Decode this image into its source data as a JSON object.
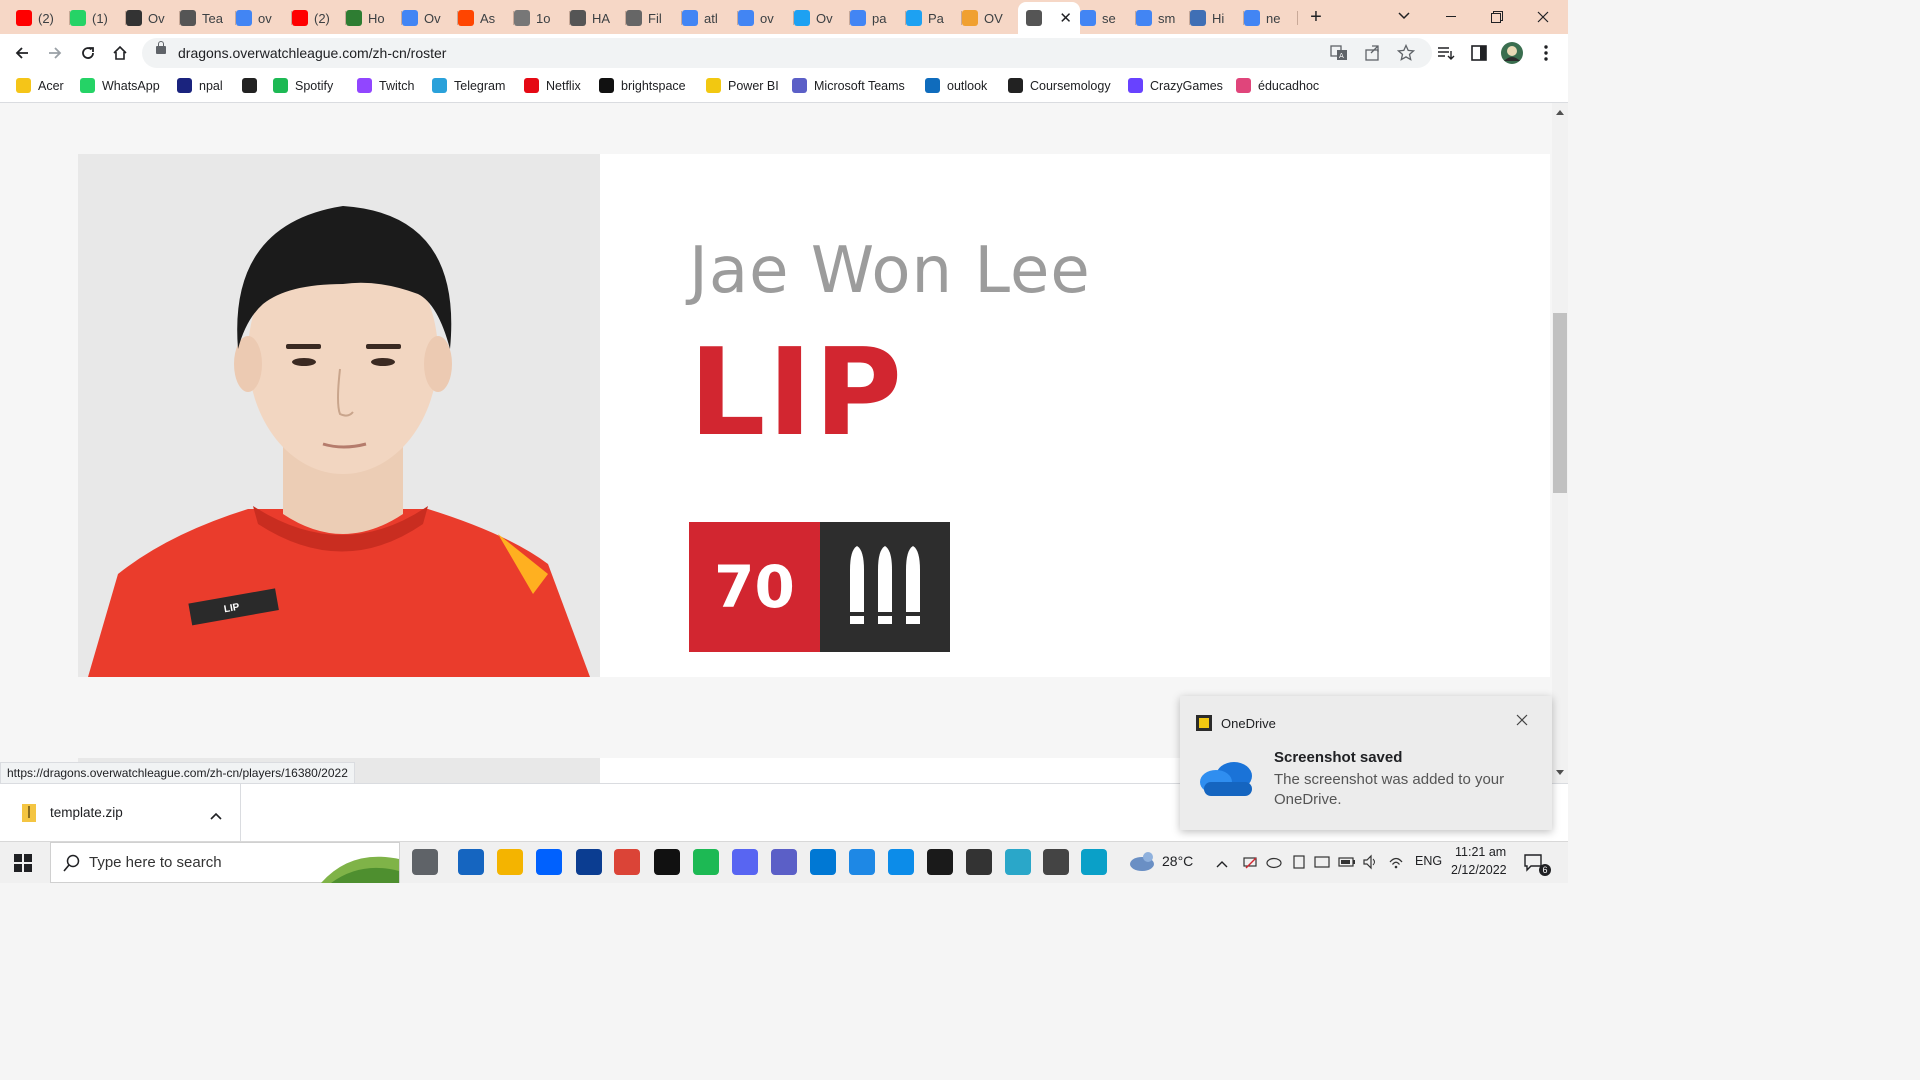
{
  "tabs": [
    {
      "label": "(2)",
      "icon": "youtube-icon",
      "color": "#ff0000"
    },
    {
      "label": "(1)",
      "icon": "whatsapp-icon",
      "color": "#25d366"
    },
    {
      "label": "Ov",
      "icon": "overwatch-icon",
      "color": "#333333"
    },
    {
      "label": "Tea",
      "icon": "flag-icon",
      "color": "#555555"
    },
    {
      "label": "ov",
      "icon": "google-icon",
      "color": "#4285f4"
    },
    {
      "label": "(2)",
      "icon": "youtube-icon",
      "color": "#ff0000"
    },
    {
      "label": "Ho",
      "icon": "w-icon",
      "color": "#2e7d32"
    },
    {
      "label": "Ov",
      "icon": "google-icon",
      "color": "#4285f4"
    },
    {
      "label": "As",
      "icon": "reddit-icon",
      "color": "#ff4500"
    },
    {
      "label": "1o",
      "icon": "globe-icon",
      "color": "#777777"
    },
    {
      "label": "HA",
      "icon": "flag-icon",
      "color": "#555555"
    },
    {
      "label": "Fil",
      "icon": "puzzle-icon",
      "color": "#666666"
    },
    {
      "label": "atl",
      "icon": "google-icon",
      "color": "#4285f4"
    },
    {
      "label": "ov",
      "icon": "google-icon",
      "color": "#4285f4"
    },
    {
      "label": "Ov",
      "icon": "twitter-icon",
      "color": "#1da1f2"
    },
    {
      "label": "pa",
      "icon": "google-icon",
      "color": "#4285f4"
    },
    {
      "label": "Pa",
      "icon": "twitter-icon",
      "color": "#1da1f2"
    },
    {
      "label": "OV",
      "icon": "overwatch-league-icon",
      "color": "#f0a030"
    },
    {
      "label": "",
      "icon": "flag-icon",
      "color": "#555555",
      "active": true
    },
    {
      "label": "se",
      "icon": "google-icon",
      "color": "#4285f4"
    },
    {
      "label": "sm",
      "icon": "google-icon",
      "color": "#4285f4"
    },
    {
      "label": "Hi",
      "icon": "globe-icon",
      "color": "#3f6fb5"
    },
    {
      "label": "ne",
      "icon": "google-icon",
      "color": "#4285f4"
    }
  ],
  "toolbar": {
    "url": "dragons.overwatchleague.com/zh-cn/roster"
  },
  "bookmarks": [
    {
      "label": "Acer",
      "icon": "folder-icon",
      "color": "#f5c518"
    },
    {
      "label": "WhatsApp",
      "icon": "whatsapp-icon",
      "color": "#25d366"
    },
    {
      "label": "npal",
      "icon": "npal-icon",
      "color": "#1a237e"
    },
    {
      "label": "",
      "icon": "globe-icon",
      "color": "#222222"
    },
    {
      "label": "Spotify",
      "icon": "spotify-icon",
      "color": "#1db954"
    },
    {
      "label": "Twitch",
      "icon": "twitch-icon",
      "color": "#9146ff"
    },
    {
      "label": "Telegram",
      "icon": "telegram-icon",
      "color": "#2aa1da"
    },
    {
      "label": "Netflix",
      "icon": "netflix-icon",
      "color": "#e50914"
    },
    {
      "label": "brightspace",
      "icon": "np-icon",
      "color": "#111111"
    },
    {
      "label": "Power BI",
      "icon": "powerbi-icon",
      "color": "#f2c811"
    },
    {
      "label": "Microsoft Teams",
      "icon": "teams-icon",
      "color": "#5b5fc7"
    },
    {
      "label": "outlook",
      "icon": "outlook-icon",
      "color": "#0f6cbd"
    },
    {
      "label": "Coursemology",
      "icon": "coursemology-icon",
      "color": "#222222"
    },
    {
      "label": "CrazyGames",
      "icon": "crazygames-icon",
      "color": "#6842ff"
    },
    {
      "label": "éducadhoc",
      "icon": "educadhoc-icon",
      "color": "#e0457b"
    }
  ],
  "player": {
    "fullname": "Jae Won Lee",
    "tag": "LIP",
    "number": "70",
    "role_icon": "damage-role-icon",
    "jersey_text": "LIP",
    "jersey_color": "#e8392b",
    "accent_color": "#d22630",
    "role_bg": "#2d2d2d"
  },
  "status_url": "https://dragons.overwatchleague.com/zh-cn/players/16380/2022",
  "downloads": {
    "file_name": "template.zip"
  },
  "toast": {
    "app": "OneDrive",
    "title": "Screenshot saved",
    "body": "The screenshot was added to your OneDrive."
  },
  "taskbar": {
    "search_placeholder": "Type here to search",
    "weather": "28°C",
    "language": "ENG",
    "time": "11:21 am",
    "date": "2/12/2022",
    "notification_count": "6"
  }
}
